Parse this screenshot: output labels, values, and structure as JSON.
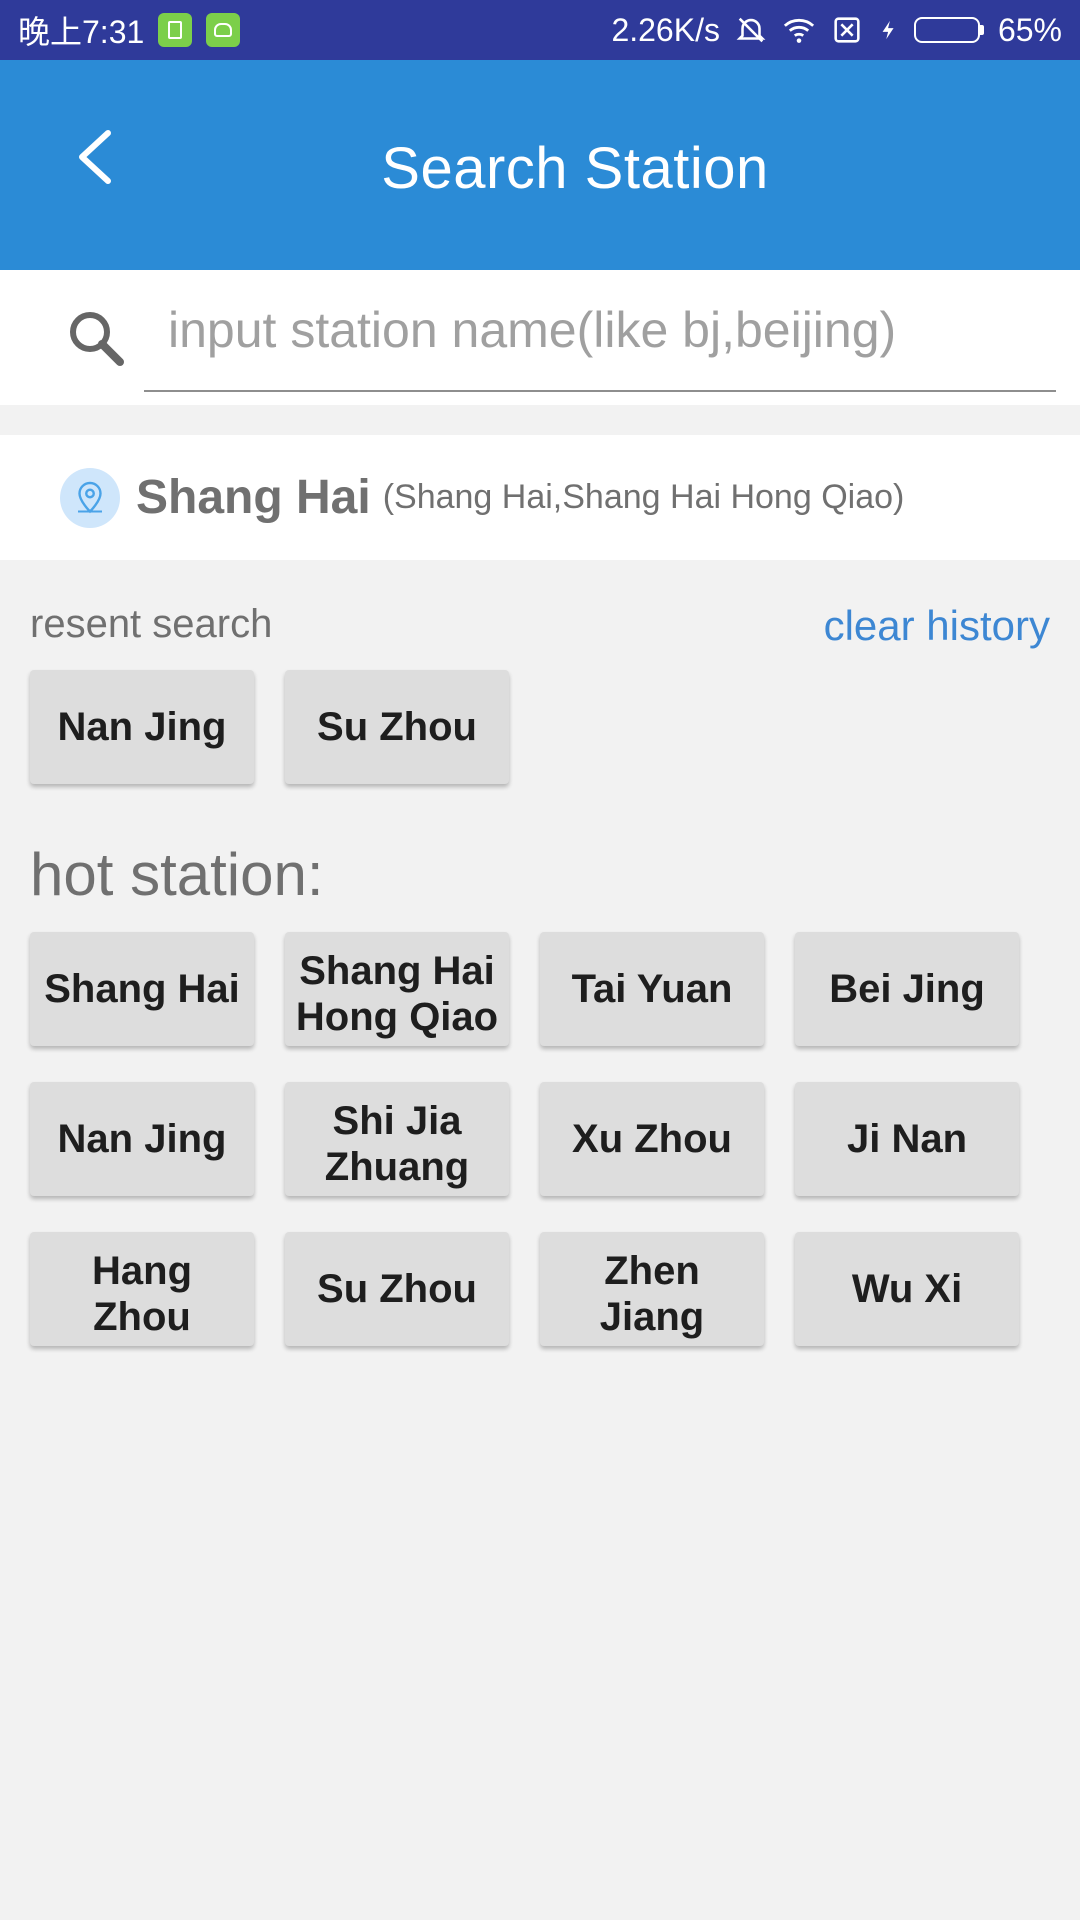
{
  "status_bar": {
    "time": "晚上7:31",
    "network_speed": "2.26K/s",
    "battery_percent": "65%",
    "battery_level": 0.65
  },
  "app_bar": {
    "title": "Search Station",
    "back_icon": "back-arrow-icon"
  },
  "search": {
    "placeholder": "input station name(like bj,beijing)",
    "value": ""
  },
  "location": {
    "city": "Shang Hai",
    "detail": "(Shang Hai,Shang Hai Hong Qiao)"
  },
  "recent": {
    "label": "resent search",
    "clear_label": "clear history",
    "items": [
      "Nan Jing",
      "Su Zhou"
    ]
  },
  "hot": {
    "label": "hot station:",
    "items": [
      "Shang Hai",
      "Shang Hai Hong Qiao",
      "Tai Yuan",
      "Bei Jing",
      "Nan Jing",
      "Shi Jia Zhuang",
      "Xu Zhou",
      "Ji Nan",
      "Hang Zhou",
      "Su Zhou",
      "Zhen Jiang",
      "Wu Xi"
    ]
  },
  "colors": {
    "status_bar": "#2f3a9a",
    "app_bar": "#2b8bd6",
    "accent_link": "#3d87d3",
    "chip_bg": "#dddddd"
  }
}
